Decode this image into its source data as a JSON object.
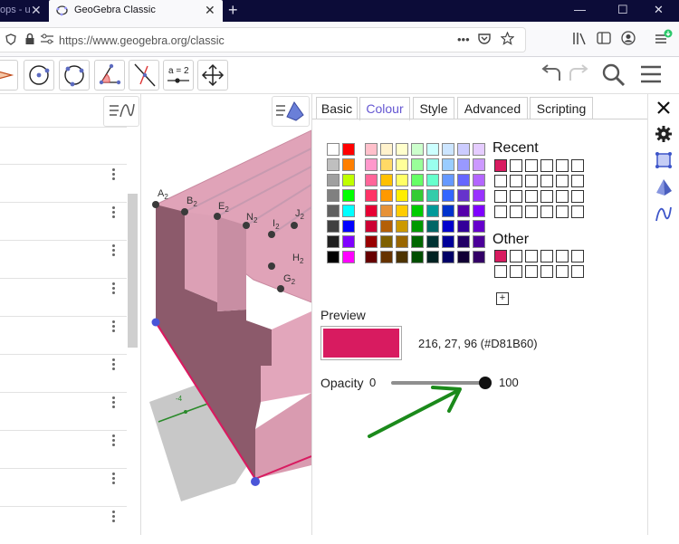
{
  "browser": {
    "prev_tab_title": "ops - u",
    "active_tab_title": "GeoGebra Classic",
    "url": "https://www.geogebra.org/classic",
    "more_label": "•••",
    "new_tab": "+",
    "close_glyph": "✕",
    "minimize_glyph": "—",
    "maximize_glyph": "☐"
  },
  "toolbar": {
    "tools": [
      {
        "icon": "polygon-icon"
      },
      {
        "icon": "circle-center-point-icon"
      },
      {
        "icon": "circle-three-points-icon"
      },
      {
        "icon": "angle-icon"
      },
      {
        "icon": "perpendicular-line-icon"
      },
      {
        "icon": "slider-tool-icon",
        "label": "a = 2"
      },
      {
        "icon": "move-graphics-view-icon"
      }
    ]
  },
  "graphics": {
    "points": [
      {
        "label": "A",
        "sub": "2"
      },
      {
        "label": "B",
        "sub": "2"
      },
      {
        "label": "E",
        "sub": "2"
      },
      {
        "label": "N",
        "sub": "2"
      },
      {
        "label": "I",
        "sub": "2"
      },
      {
        "label": "J",
        "sub": "2"
      },
      {
        "label": "H",
        "sub": "2"
      },
      {
        "label": "G",
        "sub": "2"
      }
    ],
    "axis_tick": "-4"
  },
  "properties": {
    "tabs": [
      "Basic",
      "Colour",
      "Style",
      "Advanced",
      "Scripting"
    ],
    "active_tab": "Colour",
    "recent_label": "Recent",
    "other_label": "Other",
    "preview_label": "Preview",
    "color_value": "216, 27, 96 (#D81B60)",
    "selected_color": "#D81B60",
    "opacity_label": "Opacity",
    "opacity_min": "0",
    "opacity_max": "100",
    "opacity_value": 100,
    "plus_label": "+",
    "close_glyph": "✕",
    "gray_column": [
      "#ffffff",
      "#bfbfbf",
      "#a0a0a0",
      "#808080",
      "#606060",
      "#404040",
      "#202020",
      "#000000"
    ],
    "bright_column": [
      "#ff0000",
      "#ff7f00",
      "#bfff00",
      "#00ff00",
      "#00ffff",
      "#0000ff",
      "#7f00ff",
      "#ff00ff"
    ],
    "palette_rows": [
      [
        "#ffc0cb",
        "#ff99cc",
        "#ff6699",
        "#ff3366",
        "#e60033",
        "#cc0033",
        "#990000",
        "#660000"
      ],
      [
        "#fff2cc",
        "#ffd966",
        "#ffc000",
        "#ff9900",
        "#e69138",
        "#b45f06",
        "#7f6000",
        "#663300"
      ],
      [
        "#ffffcc",
        "#ffff99",
        "#ffff66",
        "#ffee00",
        "#ffcc00",
        "#cc9900",
        "#996600",
        "#4d3300"
      ],
      [
        "#ccffcc",
        "#99ff99",
        "#66ff66",
        "#33cc33",
        "#00cc00",
        "#009900",
        "#006600",
        "#004d00"
      ],
      [
        "#ccffff",
        "#99ffee",
        "#66ffcc",
        "#33ccaa",
        "#009999",
        "#006666",
        "#003333",
        "#002222"
      ],
      [
        "#cce5ff",
        "#99ccff",
        "#6699ff",
        "#3366ff",
        "#0033cc",
        "#0000cc",
        "#000099",
        "#000066"
      ],
      [
        "#ccccff",
        "#9999ff",
        "#6666ff",
        "#6633cc",
        "#5500aa",
        "#330099",
        "#220066",
        "#110033"
      ],
      [
        "#e5ccff",
        "#cc99ff",
        "#b366ff",
        "#9933ff",
        "#7f00ff",
        "#6600cc",
        "#4c0099",
        "#330066"
      ]
    ],
    "recent_colors": [
      "#D81B60"
    ],
    "other_colors": [
      "#D81B60"
    ]
  },
  "sidebar": {
    "icons": [
      "close-icon",
      "gear-icon",
      "graphics-style-icon",
      "pyramid-icon",
      "function-graph-icon"
    ]
  }
}
